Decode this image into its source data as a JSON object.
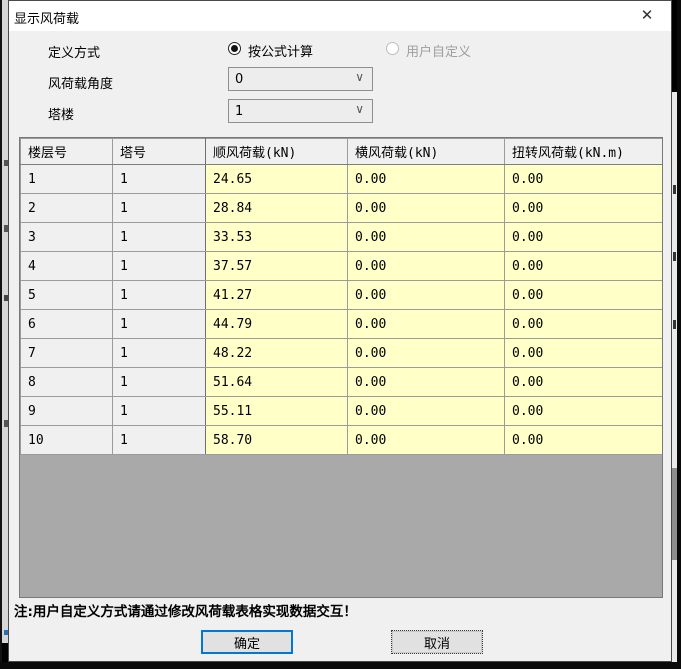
{
  "window": {
    "title": "显示风荷载",
    "close_glyph": "✕"
  },
  "form": {
    "define_label": "定义方式",
    "radio_formula_label": "按公式计算",
    "radio_formula_selected": true,
    "radio_custom_label": "用户自定义",
    "radio_custom_enabled": false,
    "angle_label": "风荷载角度",
    "angle_value": "0",
    "tower_label": "塔楼",
    "tower_value": "1",
    "chevron_glyph": "∨"
  },
  "table": {
    "headers": [
      "楼层号",
      "塔号",
      "顺风荷载(kN)",
      "横风荷载(kN)",
      "扭转风荷载(kN.m)"
    ],
    "rows": [
      [
        "1",
        "1",
        "24.65",
        "0.00",
        "0.00"
      ],
      [
        "2",
        "1",
        "28.84",
        "0.00",
        "0.00"
      ],
      [
        "3",
        "1",
        "33.53",
        "0.00",
        "0.00"
      ],
      [
        "4",
        "1",
        "37.57",
        "0.00",
        "0.00"
      ],
      [
        "5",
        "1",
        "41.27",
        "0.00",
        "0.00"
      ],
      [
        "6",
        "1",
        "44.79",
        "0.00",
        "0.00"
      ],
      [
        "7",
        "1",
        "48.22",
        "0.00",
        "0.00"
      ],
      [
        "8",
        "1",
        "51.64",
        "0.00",
        "0.00"
      ],
      [
        "9",
        "1",
        "55.11",
        "0.00",
        "0.00"
      ],
      [
        "10",
        "1",
        "58.70",
        "0.00",
        "0.00"
      ]
    ]
  },
  "note": "注:用户自定义方式请通过修改风荷载表格实现数据交互！",
  "buttons": {
    "ok": "确定",
    "cancel": "取消"
  },
  "colors": {
    "dialog_bg": "#f0f0f0",
    "titlebar_bg": "#ffffff",
    "cell_yellow": "#ffffc8",
    "grid_empty_gray": "#a9a9a9",
    "accent_blue": "#0078d7",
    "disabled_text": "#9e9e9e"
  }
}
